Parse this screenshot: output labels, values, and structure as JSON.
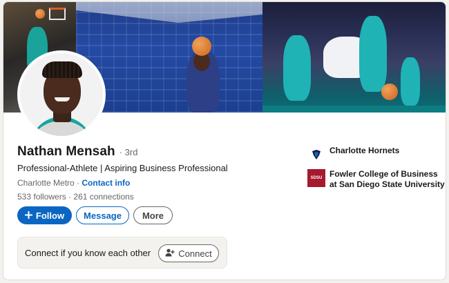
{
  "profile": {
    "name": "Nathan Mensah",
    "degree": "· 3rd",
    "headline": "Professional-Athlete | Aspiring Business Professional",
    "location": "Charlotte Metro",
    "separator": " · ",
    "contact_info": "Contact info",
    "followers": "533 followers",
    "stats_separator": " · ",
    "connections": "261 connections"
  },
  "actions": {
    "follow": "Follow",
    "follow_icon": "plus-icon",
    "message": "Message",
    "more": "More"
  },
  "connect_prompt": {
    "text": "Connect if you know each other",
    "button": "Connect",
    "button_icon": "person-add-icon"
  },
  "experience": [
    {
      "name": "Charlotte Hornets",
      "logo": "hornets-logo"
    },
    {
      "name": "Fowler College of Business at San Diego State University",
      "logo": "sdsu-logo"
    }
  ],
  "sdsu_logo_text": "SDSU",
  "colors": {
    "brand_blue": "#0a66c2",
    "text_primary": "#191919",
    "text_secondary": "#666666",
    "sdsu_red": "#a6192e",
    "hornets_teal": "#19a3a0"
  }
}
